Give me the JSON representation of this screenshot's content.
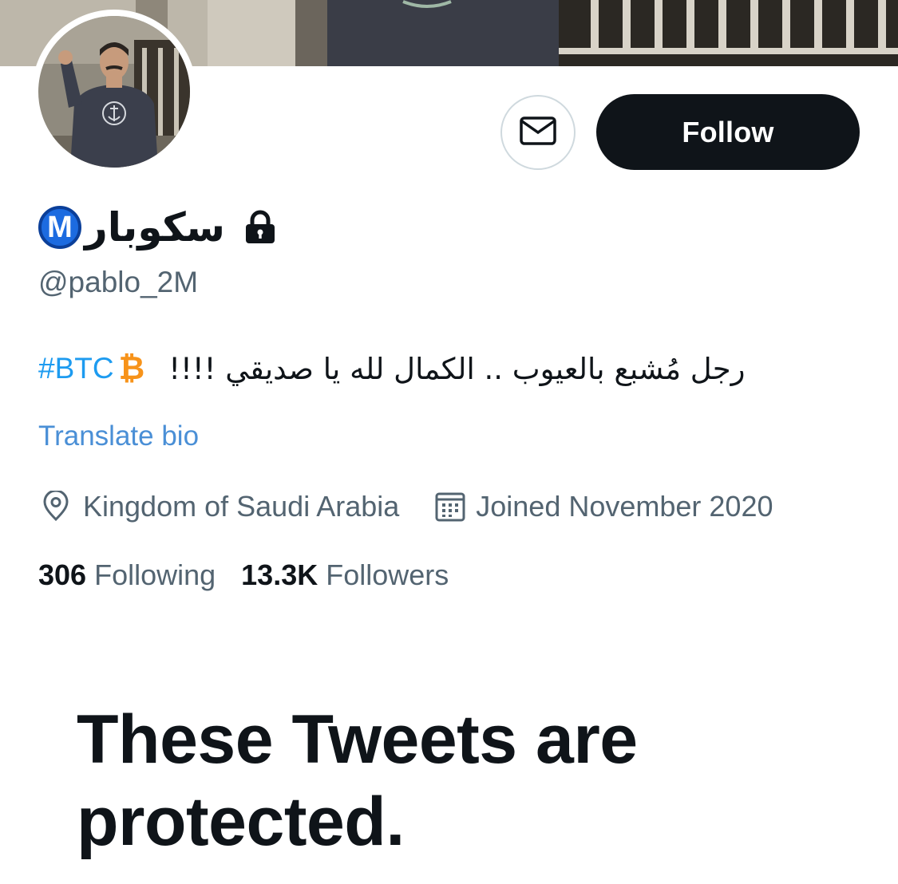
{
  "header": {
    "follow_label": "Follow",
    "message_icon": "envelope-icon"
  },
  "profile": {
    "display_name": "سكوبار",
    "badge_letter": "M",
    "badge_color": "#1c6be0",
    "lock_icon": "lock-icon",
    "handle": "@pablo_2M",
    "bio": {
      "text": "رجل مُشبع بالعيوب .. الكمال لله يا صديقي !!!!",
      "btc_symbol": "₿",
      "btc_color": "#f7931a",
      "hashtag": "#BTC"
    },
    "translate_label": "Translate bio",
    "location_icon": "location-pin-icon",
    "location": "Kingdom of Saudi Arabia",
    "calendar_icon": "calendar-icon",
    "joined": "Joined November 2020"
  },
  "stats": {
    "following_count": "306",
    "following_label": "Following",
    "followers_count": "13.3K",
    "followers_label": "Followers"
  },
  "protected": {
    "title": "These Tweets are protected."
  },
  "colors": {
    "primary_text": "#0f1419",
    "secondary_text": "#536471",
    "link": "#1d9bf0",
    "button_dark": "#0f1419"
  }
}
